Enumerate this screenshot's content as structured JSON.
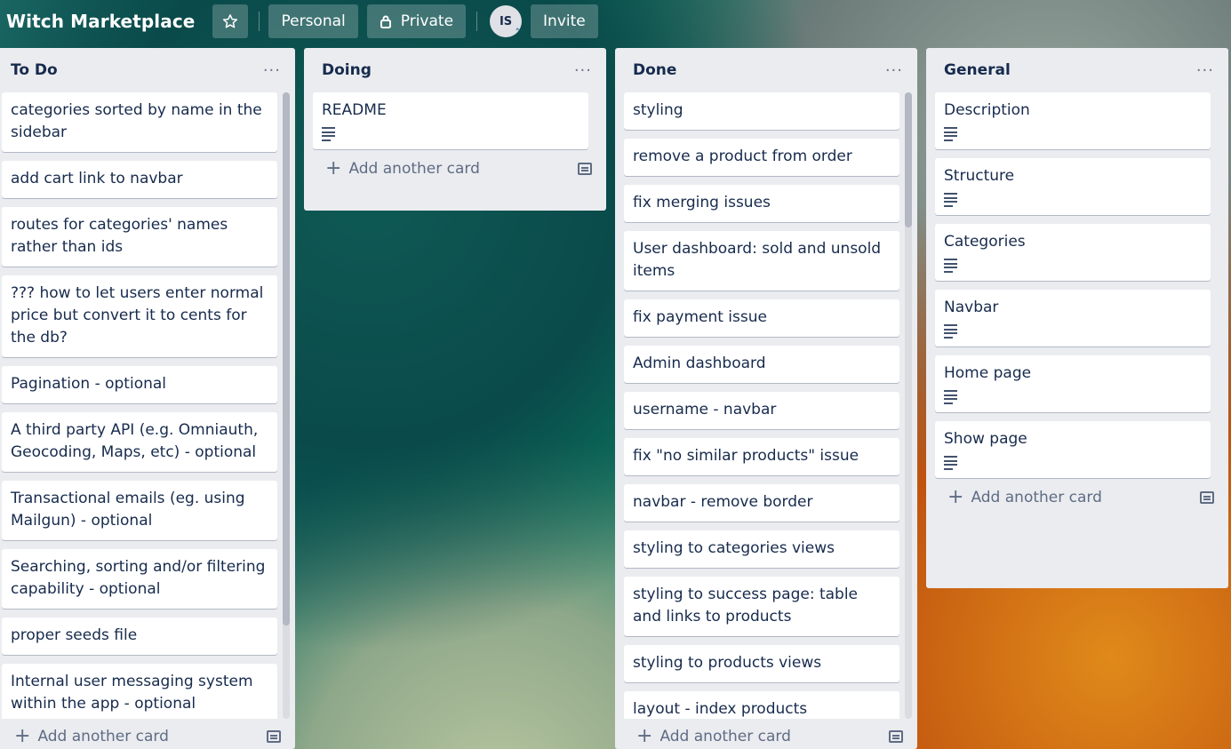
{
  "board": {
    "title": "Witch Marketplace",
    "personal_label": "Personal",
    "private_label": "Private",
    "avatar_initials": "IS",
    "invite_label": "Invite"
  },
  "lists": [
    {
      "title": "To Do",
      "add_label": "Add another card",
      "cards": [
        {
          "text": "categories sorted by name in the sidebar",
          "has_desc": false
        },
        {
          "text": "add cart link to navbar",
          "has_desc": false
        },
        {
          "text": "routes for categories' names rather than ids",
          "has_desc": false
        },
        {
          "text": "??? how to let users enter normal price but convert it to cents for the db?",
          "has_desc": false
        },
        {
          "text": "Pagination - optional",
          "has_desc": false
        },
        {
          "text": "A third party API (e.g. Omniauth, Geocoding, Maps, etc) - optional",
          "has_desc": false
        },
        {
          "text": "Transactional emails (eg. using Mailgun) - optional",
          "has_desc": false
        },
        {
          "text": "Searching, sorting and/or filtering capability - optional",
          "has_desc": false
        },
        {
          "text": "proper seeds file",
          "has_desc": false
        },
        {
          "text": "Internal user messaging system within the app - optional",
          "has_desc": false
        }
      ]
    },
    {
      "title": "Doing",
      "add_label": "Add another card",
      "cards": [
        {
          "text": "README",
          "has_desc": true
        }
      ]
    },
    {
      "title": "Done",
      "add_label": "Add another card",
      "cards": [
        {
          "text": "styling",
          "has_desc": false
        },
        {
          "text": "remove a product from order",
          "has_desc": false
        },
        {
          "text": "fix merging issues",
          "has_desc": false
        },
        {
          "text": "User dashboard: sold and unsold items",
          "has_desc": false
        },
        {
          "text": "fix payment issue",
          "has_desc": false
        },
        {
          "text": "Admin dashboard",
          "has_desc": false
        },
        {
          "text": "username - navbar",
          "has_desc": false
        },
        {
          "text": "fix \"no similar products\" issue",
          "has_desc": false
        },
        {
          "text": "navbar - remove border",
          "has_desc": false
        },
        {
          "text": "styling to categories views",
          "has_desc": false
        },
        {
          "text": "styling to success page: table and links to products",
          "has_desc": false
        },
        {
          "text": "styling to products views",
          "has_desc": false
        },
        {
          "text": "layout - index products",
          "has_desc": false
        }
      ]
    },
    {
      "title": "General",
      "add_label": "Add another card",
      "cards": [
        {
          "text": "Description",
          "has_desc": true
        },
        {
          "text": "Structure",
          "has_desc": true
        },
        {
          "text": "Categories",
          "has_desc": true
        },
        {
          "text": "Navbar",
          "has_desc": true
        },
        {
          "text": "Home page",
          "has_desc": true
        },
        {
          "text": "Show page",
          "has_desc": true
        }
      ]
    }
  ]
}
